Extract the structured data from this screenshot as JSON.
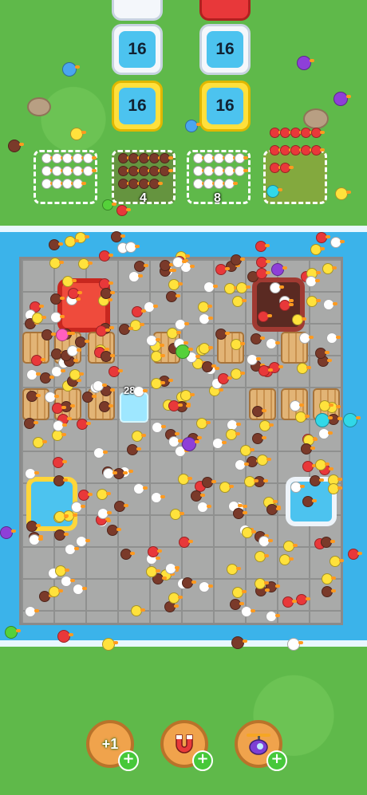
{
  "colors": {
    "grass": "#5fb94a",
    "water": "#3bb3ea",
    "board": "#a9aaa9",
    "duck_white": "#ffffff",
    "duck_yellow": "#ffe23c",
    "duck_red": "#e8383a",
    "duck_brown": "#7a3a2a",
    "duck_blue": "#4aa6f0",
    "duck_purple": "#8e3fd8",
    "duck_cyan": "#31d8e8",
    "duck_pink": "#ff5fbf",
    "duck_green": "#55d13a"
  },
  "top_blocks": [
    {
      "value": "16",
      "color": "white"
    },
    {
      "value": "16",
      "color": "white"
    },
    {
      "value": "16",
      "color": "yellow"
    },
    {
      "value": "16",
      "color": "yellow"
    }
  ],
  "slots": [
    {
      "color": "white",
      "count": ""
    },
    {
      "color": "brown",
      "count": "4"
    },
    {
      "color": "white",
      "count": "8"
    },
    {
      "color": "red",
      "count": ""
    }
  ],
  "ice_block": {
    "count": "28"
  },
  "powerups": [
    {
      "name": "plus-one",
      "label": "+1",
      "icon": "plus-one-icon"
    },
    {
      "name": "magnet",
      "label": "",
      "icon": "magnet-icon"
    },
    {
      "name": "helicopter",
      "label": "",
      "icon": "helicopter-icon"
    }
  ]
}
